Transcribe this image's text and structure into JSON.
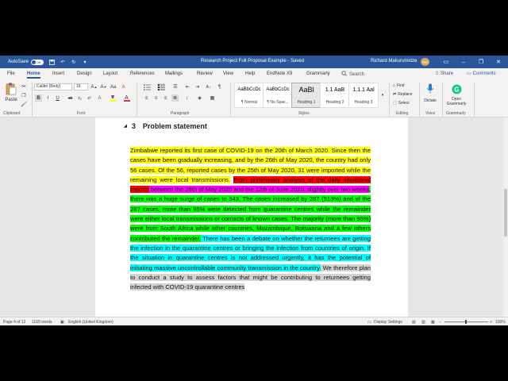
{
  "titlebar": {
    "autosave_label": "AutoSave",
    "autosave_state": "Off",
    "document_title": "Research Project Full Proposal Example",
    "save_status": "Saved",
    "user_name": "Richard Makurumidze",
    "user_initials": "RM",
    "accent_color": "#2b579a"
  },
  "tabs": [
    "File",
    "Home",
    "Insert",
    "Design",
    "Layout",
    "References",
    "Mailings",
    "Review",
    "View",
    "Help",
    "EndNote X9",
    "Grammarly"
  ],
  "active_tab": "Home",
  "search": {
    "placeholder": "Search"
  },
  "share_label": "Share",
  "comments_label": "Comments",
  "ribbon": {
    "clipboard": {
      "paste_label": "Paste",
      "group_label": "Clipboard"
    },
    "font": {
      "font_name": "Calibri (Body)",
      "font_size": "16",
      "group_label": "Font"
    },
    "paragraph": {
      "group_label": "Paragraph"
    },
    "styles": {
      "group_label": "Styles",
      "items": [
        {
          "sample": "AaBbCcDc",
          "name": "¶ Normal"
        },
        {
          "sample": "AaBbCcDc",
          "name": "¶ No Spac..."
        },
        {
          "sample": "AaBl",
          "name": "Heading 1"
        },
        {
          "sample": "1.1 AaB",
          "name": "Heading 2"
        },
        {
          "sample": "1.1.1 Aal",
          "name": "Heading 3"
        }
      ]
    },
    "editing": {
      "find_label": "Find",
      "replace_label": "Replace",
      "select_label": "Select",
      "group_label": "Editing"
    },
    "voice": {
      "dictate_label": "Dictate",
      "group_label": "Voice"
    },
    "grammarly": {
      "open_label": "Open",
      "open_label2": "Grammarly",
      "group_label": "Grammarly"
    }
  },
  "document": {
    "heading_number": "3",
    "heading_text": "Problem statement",
    "paragraph": [
      {
        "text": "Zimbabwe reported its first case of COVID-19 on the 20th of March 2020. Since then the cases have been gradually increasing, and by the 26th of May 2020, the country had only 56 cases. Of the 56, reported cases by the 25th of May 2020, 31 were imported while the remaining were local transmissions.",
        "highlight": "yellow"
      },
      {
        "text": " ",
        "highlight": "none"
      },
      {
        "text": "From preliminary analysis of the daily situational reports",
        "highlight": "red"
      },
      {
        "text": " between the 26th of May 2020 and the 12th of June 2020, slightly over two weeks",
        "highlight": "magenta"
      },
      {
        "text": ", there was a huge surge of cases to 343. The cases increased by 287 (513%) and of the 287 cases, more than 95% were detected from quarantine centres while the remainder were either local transmissions or contacts of known cases. The majority (more than 95%) were from South Africa while other countries, Mozambique, Botswana and a few others contributed the remainder.",
        "highlight": "green"
      },
      {
        "text": " There has been a debate on whether the returnees are getting the infection in the quarantine centres or bringing the infection from countries of origin. If the situation in quarantine centres is not addressed urgently, it has the potential of initiating massive uncontrollable community transmission in the country.",
        "highlight": "cyan"
      },
      {
        "text": " We therefore plan to conduct a study to assess factors that might be contributing to returnees getting infected with COVID-19 quarantine centres",
        "highlight": "gray"
      }
    ]
  },
  "statusbar": {
    "page_info": "Page 4 of 12",
    "word_count": "1169 words",
    "language": "English (United Kingdom)",
    "display_settings": "Display Settings",
    "zoom": "100%"
  }
}
